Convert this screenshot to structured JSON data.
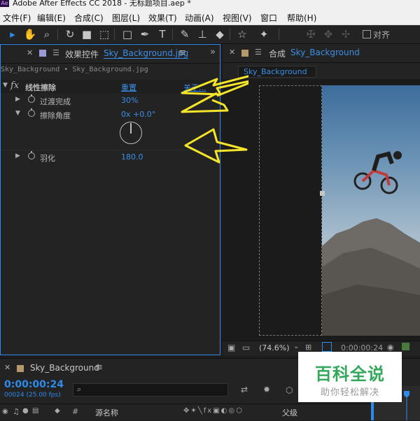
{
  "window": {
    "title": "Adobe After Effects CC 2018 - 无标题项目.aep *",
    "logo": "Ae"
  },
  "menu": [
    "文件(F)",
    "编辑(E)",
    "合成(C)",
    "图层(L)",
    "效果(T)",
    "动画(A)",
    "视图(V)",
    "窗口",
    "帮助(H)"
  ],
  "toolbar": {
    "align_label": "对齐"
  },
  "effect_controls": {
    "panel_label": "效果控件",
    "tab_name": "Sky_Background.jpg",
    "subheader": "Sky_Background • Sky_Background.jpg",
    "effect": {
      "fx": "fx",
      "name": "线性擦除",
      "reset": "重置",
      "about": "关于..."
    },
    "props": [
      {
        "name": "过渡完成",
        "value": "30%"
      },
      {
        "name": "擦除角度",
        "value": "0x +0.0°"
      },
      {
        "name": "羽化",
        "value": "180.0"
      }
    ]
  },
  "composition": {
    "panel_label": "合成",
    "name": "Sky_Background",
    "chip": "Sky_Background",
    "zoom": "(74.6%)",
    "timecode": "0:00:00:24"
  },
  "timeline": {
    "comp_name": "Sky_Background",
    "timecode": "0:00:00:24",
    "frames": "00024 (25.00 fps)",
    "col_hash": "#",
    "col_source": "源名称",
    "col_parent": "父级"
  },
  "watermark": {
    "main": "百科全说",
    "sub": "助你轻松解决"
  },
  "colors": {
    "accent": "#2d8ceb",
    "value_blue": "#3b8fe8",
    "annotation_yellow": "#f5e52a",
    "watermark_green": "#33a85a"
  }
}
